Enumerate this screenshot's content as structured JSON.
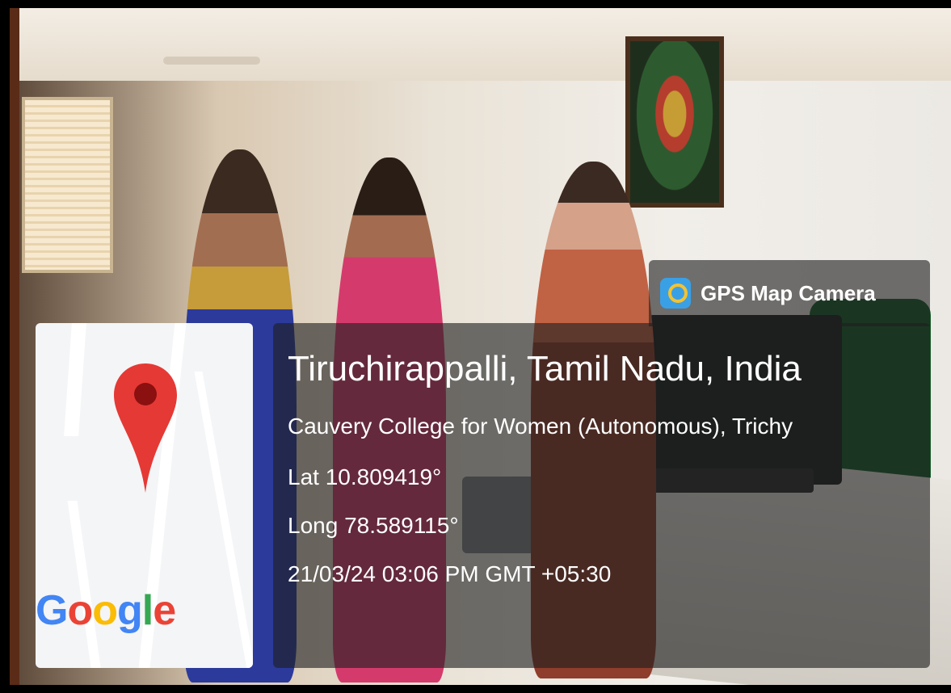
{
  "overlay": {
    "brand": "GPS Map Camera",
    "location_title": "Tiruchirappalli, Tamil Nadu, India",
    "address": "Cauvery College for Women (Autonomous), Trichy",
    "latitude": "Lat 10.809419°",
    "longitude": "Long 78.589115°",
    "datetime": "21/03/24 03:06 PM GMT +05:30"
  },
  "map": {
    "logo_text": [
      "G",
      "o",
      "o",
      "g",
      "l",
      "e"
    ],
    "logo_colors": [
      "#4285F4",
      "#EA4335",
      "#FBBC05",
      "#4285F4",
      "#34A853",
      "#EA4335"
    ],
    "pin_color": "#E53935",
    "icon_name": "location-pin-icon"
  },
  "brand_icon": "gps-map-camera-icon"
}
